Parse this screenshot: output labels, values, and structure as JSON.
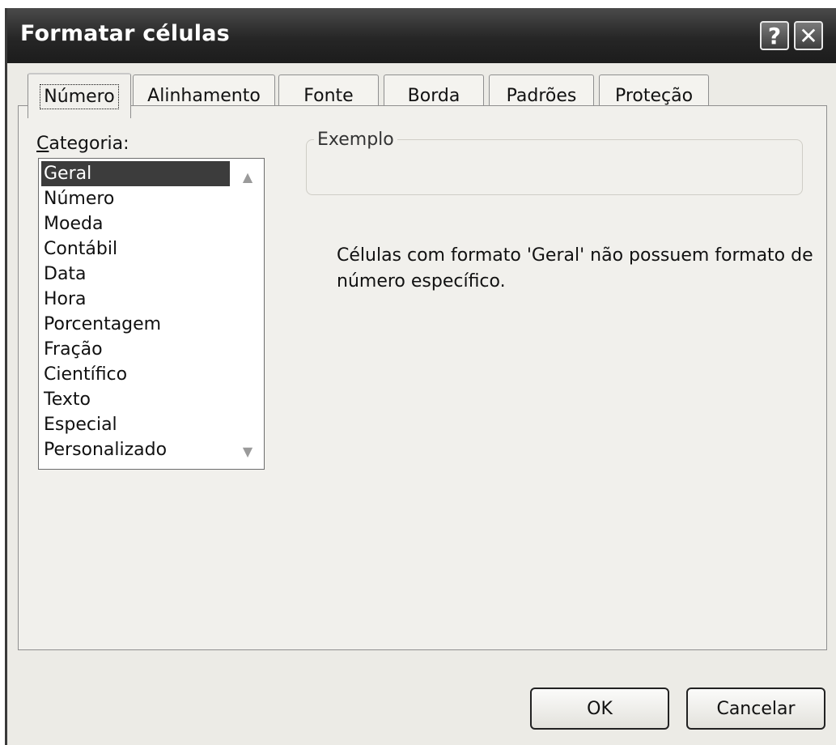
{
  "window": {
    "title": "Formatar células",
    "help_glyph": "?",
    "close_glyph": "✕"
  },
  "tabs": [
    {
      "label": "Número",
      "active": true
    },
    {
      "label": "Alinhamento",
      "active": false
    },
    {
      "label": "Fonte",
      "active": false
    },
    {
      "label": "Borda",
      "active": false
    },
    {
      "label": "Padrões",
      "active": false
    },
    {
      "label": "Proteção",
      "active": false
    }
  ],
  "category": {
    "label_first_letter": "C",
    "label_rest": "ategoria:",
    "items": [
      "Geral",
      "Número",
      "Moeda",
      "Contábil",
      "Data",
      "Hora",
      "Porcentagem",
      "Fração",
      "Científico",
      "Texto",
      "Especial",
      "Personalizado"
    ],
    "selected": "Geral",
    "scroll_up_glyph": "▲",
    "scroll_down_glyph": "▼"
  },
  "example": {
    "legend": "Exemplo",
    "value": ""
  },
  "description": "Células com formato 'Geral' não possuem formato de número específico.",
  "buttons": {
    "ok": "OK",
    "cancel": "Cancelar"
  }
}
